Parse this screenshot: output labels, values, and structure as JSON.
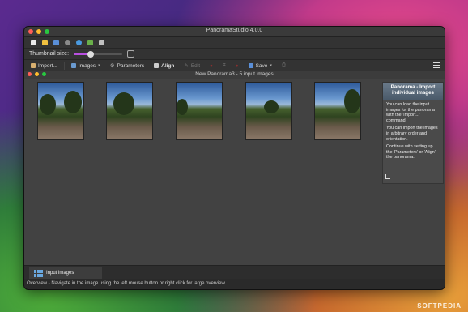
{
  "window": {
    "title": "PanoramaStudio 4.0.0"
  },
  "iconbar": {
    "icons": [
      "new-file-icon",
      "open-folder-icon",
      "save-disk-icon",
      "settings-icon",
      "help-icon",
      "export-icon",
      "share-icon"
    ]
  },
  "thumbnail": {
    "label": "Thumbnail size:",
    "size_fraction": 0.35
  },
  "toolbar": {
    "import_label": "Import...",
    "images_label": "Images",
    "parameters_label": "Parameters",
    "align_label": "Align",
    "edit_label": "Edit",
    "save_label": "Save"
  },
  "document": {
    "title": "New Panorama3 - 5 input images",
    "image_count": 5
  },
  "help_panel": {
    "title": "Panorama - Import individual images",
    "p1": "You can load the input images for the panorama with the 'Import...' command.",
    "p2": "You can import the images in arbitrary order and orientation.",
    "p3": "Continue with setting up the 'Parameters' or 'Align' the panorama."
  },
  "bottom_tab": {
    "label": "Input images"
  },
  "status": {
    "text": "Overview - Navigate in the image using the left mouse button or right click for large overview"
  },
  "watermark": "SOFTPEDIA",
  "colors": {
    "accent": "#b84fe0",
    "titlebar": "#3a3a3a",
    "background": "#2b2b2b"
  }
}
